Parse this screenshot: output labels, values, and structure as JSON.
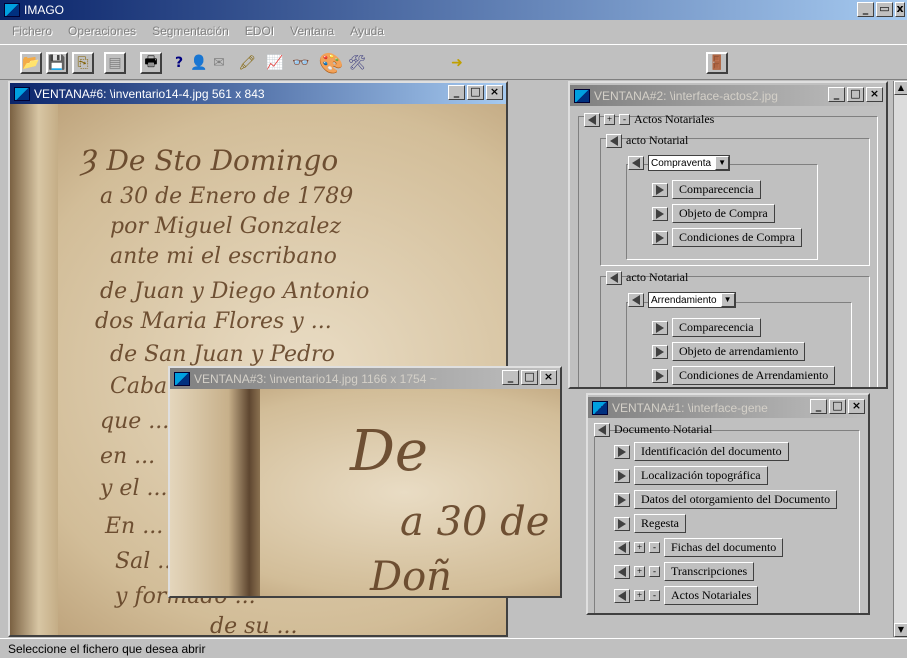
{
  "app": {
    "title": "IMAGO",
    "status": "Seleccione el fichero que desea abrir"
  },
  "menu": [
    "Fichero",
    "Operaciones",
    "Segmentación",
    "EDOI",
    "Ventana",
    "Ayuda"
  ],
  "win6": {
    "title": "VENTANA#6: \\inventario14-4.jpg   561 x 843"
  },
  "win3": {
    "title": "VENTANA#3: \\inventario14.jpg   1166 x 1754 ~"
  },
  "win2": {
    "title": "VENTANA#2: \\interface-actos2.jpg",
    "root": "Actos Notariales",
    "acto1": {
      "label": "acto Notarial",
      "combo": "Compraventa",
      "items": [
        "Comparecencia",
        "Objeto de Compra",
        "Condiciones de Compra"
      ]
    },
    "acto2": {
      "label": "acto Notarial",
      "combo": "Arrendamiento",
      "items": [
        "Comparecencia",
        "Objeto de arrendamiento",
        "Condiciones de Arrendamiento"
      ]
    }
  },
  "win1": {
    "title": "VENTANA#1: \\interface-gene",
    "root": "Documento Notarial",
    "items": [
      "Identificación del documento",
      "Localización topográfica",
      "Datos del otorgamiento del Documento",
      "Regesta"
    ],
    "groups": [
      "Fichas del documento",
      "Transcripciones",
      "Actos Notariales"
    ]
  },
  "ink6": [
    "Ȝ De Sto Domingo",
    "a 30 de Enero de 1789",
    "por Miguel Gonzalez",
    "ante mi el escribano",
    "de Juan y Diego Antonio",
    "dos Maria Flores y ...",
    "de San Juan y Pedro",
    "Caballero y ...",
    "que ...",
    "en ...",
    "y el ...",
    "En ...",
    "Sal ...",
    "y formado ...",
    "de su ..."
  ],
  "ink3": [
    "De",
    "a 30 de",
    "Doñ"
  ]
}
